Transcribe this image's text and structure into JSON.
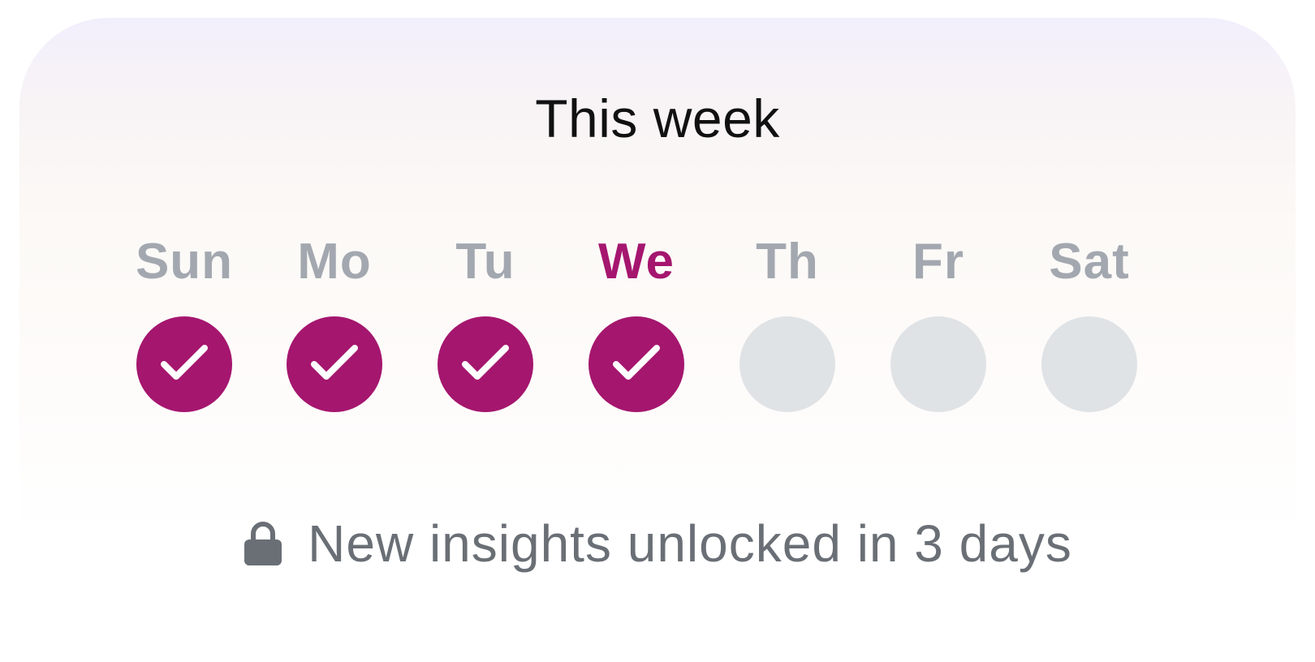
{
  "card": {
    "title": "This week",
    "accent_color": "#a5166e",
    "inactive_label_color": "#a3a8b0",
    "inactive_dot_color": "#e0e3e6"
  },
  "week": {
    "days": [
      {
        "label": "Sun",
        "completed": true,
        "today": false
      },
      {
        "label": "Mo",
        "completed": true,
        "today": false
      },
      {
        "label": "Tu",
        "completed": true,
        "today": false
      },
      {
        "label": "We",
        "completed": true,
        "today": true
      },
      {
        "label": "Th",
        "completed": false,
        "today": false
      },
      {
        "label": "Fr",
        "completed": false,
        "today": false
      },
      {
        "label": "Sat",
        "completed": false,
        "today": false
      }
    ],
    "completed_icon": "check-icon"
  },
  "footer": {
    "icon": "lock-icon",
    "text": "New insights unlocked in 3 days"
  }
}
